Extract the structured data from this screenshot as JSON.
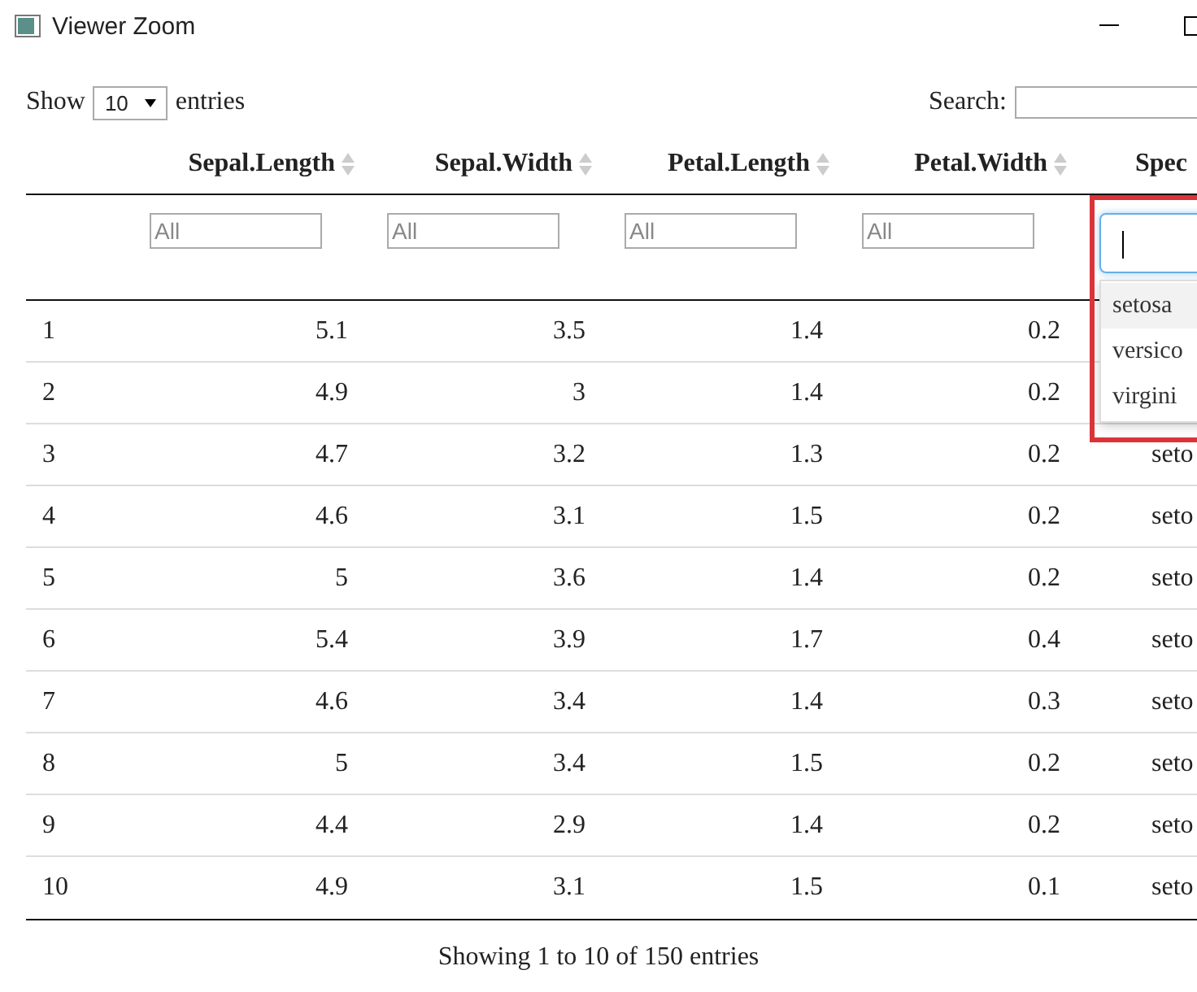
{
  "window": {
    "title": "Viewer Zoom"
  },
  "length_menu": {
    "before": "Show",
    "value": "10",
    "after": "entries"
  },
  "search": {
    "label": "Search:"
  },
  "columns": [
    {
      "label": "Sepal.Length",
      "sortable": true
    },
    {
      "label": "Sepal.Width",
      "sortable": true
    },
    {
      "label": "Petal.Length",
      "sortable": true
    },
    {
      "label": "Petal.Width",
      "sortable": true
    },
    {
      "label": "Spec",
      "sortable": false
    }
  ],
  "filters": [
    {
      "placeholder": "All"
    },
    {
      "placeholder": "All"
    },
    {
      "placeholder": "All"
    },
    {
      "placeholder": "All"
    }
  ],
  "species_filter": {
    "focused": true,
    "options": [
      {
        "label": "setosa",
        "selected": true
      },
      {
        "label": "versico",
        "selected": false
      },
      {
        "label": "virgini",
        "selected": false
      }
    ]
  },
  "rows": [
    [
      "1",
      "5.1",
      "3.5",
      "1.4",
      "0.2"
    ],
    [
      "2",
      "4.9",
      "3",
      "1.4",
      "0.2"
    ],
    [
      "3",
      "4.7",
      "3.2",
      "1.3",
      "0.2",
      "seto"
    ],
    [
      "4",
      "4.6",
      "3.1",
      "1.5",
      "0.2",
      "seto"
    ],
    [
      "5",
      "5",
      "3.6",
      "1.4",
      "0.2",
      "seto"
    ],
    [
      "6",
      "5.4",
      "3.9",
      "1.7",
      "0.4",
      "seto"
    ],
    [
      "7",
      "4.6",
      "3.4",
      "1.4",
      "0.3",
      "seto"
    ],
    [
      "8",
      "5",
      "3.4",
      "1.5",
      "0.2",
      "seto"
    ],
    [
      "9",
      "4.4",
      "2.9",
      "1.4",
      "0.2",
      "seto"
    ],
    [
      "10",
      "4.9",
      "3.1",
      "1.5",
      "0.1",
      "seto"
    ]
  ],
  "info": "Showing 1 to 10 of 150 entries"
}
